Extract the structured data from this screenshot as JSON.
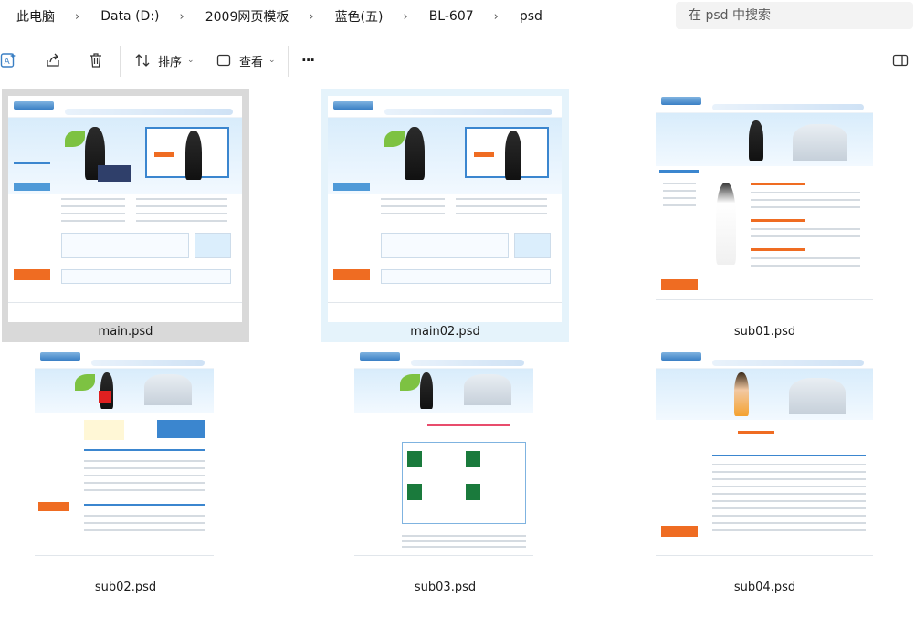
{
  "address_bar": {
    "crumbs": [
      "此电脑",
      "Data (D:)",
      "2009网页模板",
      "蓝色(五)",
      "BL-607",
      "psd"
    ],
    "search_placeholder": "在 psd 中搜索"
  },
  "command_bar": {
    "sort_label": "排序",
    "view_label": "查看",
    "more_label": "···"
  },
  "files": [
    {
      "name": "main.psd",
      "state": "selected"
    },
    {
      "name": "main02.psd",
      "state": "hover"
    },
    {
      "name": "sub01.psd",
      "state": "normal"
    },
    {
      "name": "sub02.psd",
      "state": "normal"
    },
    {
      "name": "sub03.psd",
      "state": "normal"
    },
    {
      "name": "sub04.psd",
      "state": "normal"
    }
  ],
  "icons": {
    "ai": "ai-icon",
    "share": "share-icon",
    "delete": "trash-icon",
    "sort": "sort-icon",
    "view": "view-icon",
    "details": "details-pane-icon"
  },
  "colors": {
    "selected_bg": "#d9d9d9",
    "hover_bg": "#e5f3fb",
    "thumb_accent": "#3b86cf",
    "thumb_orange": "#ef6c22"
  }
}
